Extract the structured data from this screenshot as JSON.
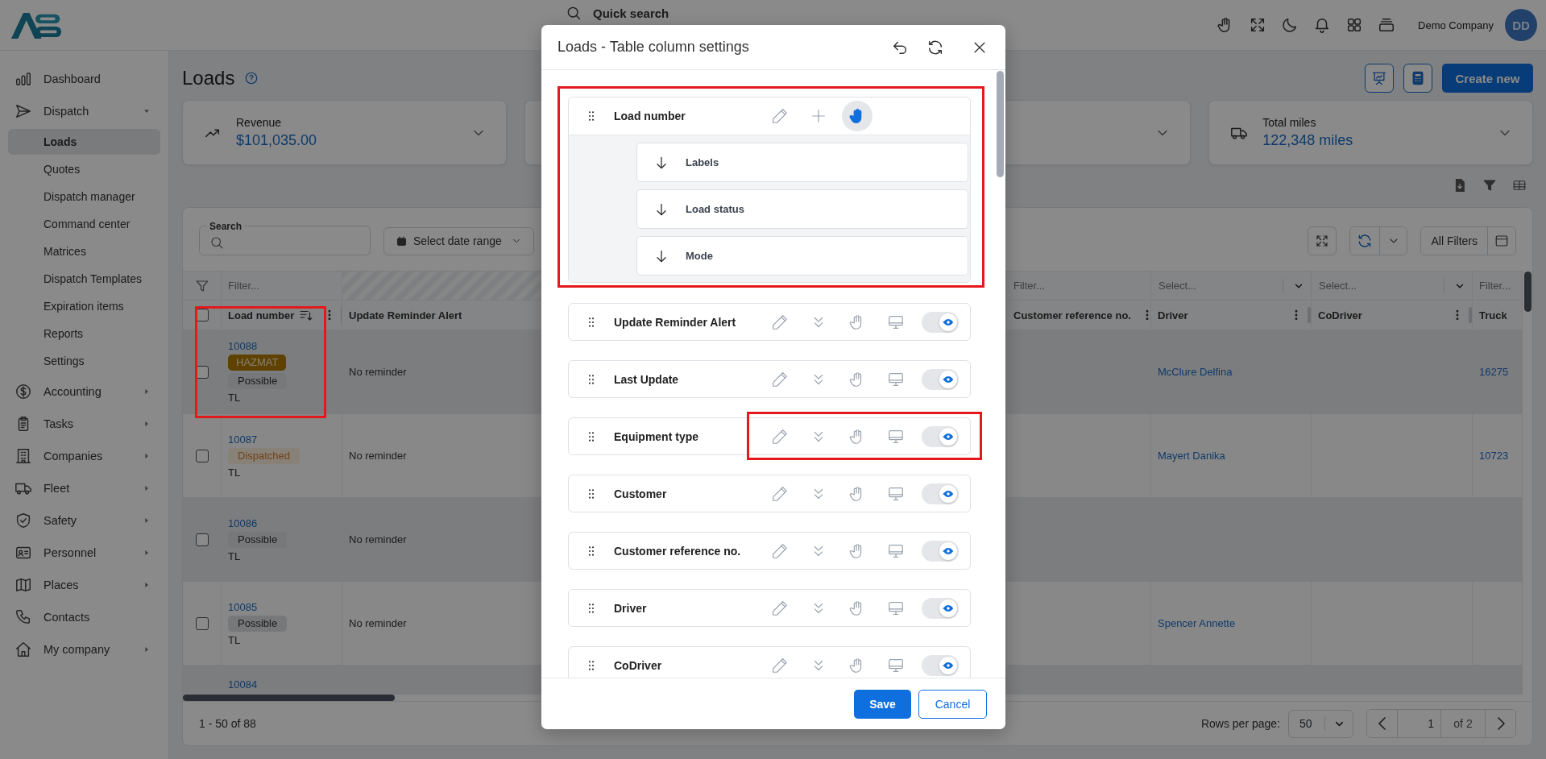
{
  "header": {
    "quick_search": {
      "placeholder": "Quick search"
    },
    "company": "Demo Company",
    "avatar": "DD"
  },
  "sidebar": {
    "items": [
      {
        "label": "Dashboard",
        "selected": false
      },
      {
        "label": "Dispatch",
        "selected": false,
        "expanded": true,
        "children": [
          {
            "label": "Loads",
            "selected": true
          },
          {
            "label": "Quotes",
            "selected": false
          },
          {
            "label": "Dispatch manager",
            "selected": false
          },
          {
            "label": "Command center",
            "selected": false
          },
          {
            "label": "Matrices",
            "selected": false
          },
          {
            "label": "Dispatch Templates",
            "selected": false
          },
          {
            "label": "Expiration items",
            "selected": false
          },
          {
            "label": "Reports",
            "selected": false
          },
          {
            "label": "Settings",
            "selected": false
          }
        ]
      },
      {
        "label": "Accounting",
        "selected": false,
        "expanded": false
      },
      {
        "label": "Tasks",
        "selected": false,
        "expanded": false
      },
      {
        "label": "Companies",
        "selected": false,
        "expanded": false
      },
      {
        "label": "Fleet",
        "selected": false,
        "expanded": false
      },
      {
        "label": "Safety",
        "selected": false,
        "expanded": false
      },
      {
        "label": "Personnel",
        "selected": false,
        "expanded": false
      },
      {
        "label": "Places",
        "selected": false,
        "expanded": false
      },
      {
        "label": "Contacts",
        "selected": false
      },
      {
        "label": "My company",
        "selected": false,
        "expanded": false
      }
    ]
  },
  "page": {
    "title": "Loads",
    "create_button": "Create new"
  },
  "stat_cards": [
    {
      "label": "Revenue",
      "value": "$101,035.00"
    },
    {
      "label": "Total miles",
      "value": "122,348 miles"
    }
  ],
  "table": {
    "search": {
      "label": "Search"
    },
    "date_range": "Select date range",
    "all_filters": "All Filters",
    "header_checkbox": {
      "checked": false
    },
    "columns": [
      {
        "title": "Load number",
        "filter": {
          "kind": "text",
          "placeholder": "Filter..."
        }
      },
      {
        "title": "Update Reminder Alert",
        "filter": {
          "kind": "none"
        }
      },
      {
        "title": "Customer reference no.",
        "filter": {
          "kind": "text",
          "placeholder": "Filter..."
        }
      },
      {
        "title": "Driver",
        "filter": {
          "kind": "select",
          "placeholder": "Select..."
        }
      },
      {
        "title": "CoDriver",
        "filter": {
          "kind": "select",
          "placeholder": "Select..."
        }
      },
      {
        "title": "Truck",
        "filter": {
          "kind": "text",
          "placeholder": "Filter..."
        }
      }
    ],
    "rows": [
      {
        "checked": false,
        "highlighted": true,
        "load_number": "10088",
        "tags": [
          {
            "label": "HAZMAT",
            "kind": "hazmat"
          },
          {
            "label": "Possible",
            "kind": "neutral"
          }
        ],
        "mode": "TL",
        "reminder": "No reminder",
        "driver": "McClure Delfina",
        "truck": "16275"
      },
      {
        "checked": false,
        "highlighted": false,
        "load_number": "10087",
        "tags": [
          {
            "label": "Dispatched",
            "kind": "warning"
          }
        ],
        "mode": "TL",
        "reminder": "No reminder",
        "driver": "Mayert Danika",
        "truck": "10723"
      },
      {
        "checked": false,
        "highlighted": false,
        "load_number": "10086",
        "tags": [
          {
            "label": "Possible",
            "kind": "neutral"
          }
        ],
        "mode": "TL",
        "reminder": "No reminder"
      },
      {
        "checked": false,
        "highlighted": false,
        "load_number": "10085",
        "tags": [
          {
            "label": "Possible",
            "kind": "neutral"
          }
        ],
        "mode": "TL",
        "reminder": "No reminder",
        "driver": "Spencer Annette"
      },
      {
        "highlighted": false,
        "load_number": "10084"
      }
    ],
    "footer": {
      "range": "1 - 50 of 88",
      "rows_per_page_label": "Rows per page:",
      "rows_per_page": "50",
      "page": "1",
      "page_count": "of 2"
    }
  },
  "column_settings": {
    "title": "Loads - Table column settings",
    "items": [
      {
        "kind": "group",
        "label": "Load number",
        "frozen": true,
        "highlighted": true,
        "children": [
          {
            "label": "Labels"
          },
          {
            "label": "Load status"
          },
          {
            "label": "Mode"
          }
        ]
      },
      {
        "kind": "column",
        "label": "Update Reminder Alert",
        "frozen": false,
        "visible": true,
        "highlighted": false
      },
      {
        "kind": "column",
        "label": "Last Update",
        "frozen": false,
        "visible": true,
        "highlighted": false
      },
      {
        "kind": "column",
        "label": "Equipment type",
        "frozen": false,
        "visible": true,
        "highlighted": true
      },
      {
        "kind": "column",
        "label": "Customer",
        "frozen": false,
        "visible": true,
        "highlighted": false
      },
      {
        "kind": "column",
        "label": "Customer reference no.",
        "frozen": false,
        "visible": true,
        "highlighted": false
      },
      {
        "kind": "column",
        "label": "Driver",
        "frozen": false,
        "visible": true,
        "highlighted": false
      },
      {
        "kind": "column",
        "label": "CoDriver",
        "frozen": false,
        "visible": true,
        "highlighted": false
      }
    ],
    "save": "Save",
    "cancel": "Cancel"
  }
}
